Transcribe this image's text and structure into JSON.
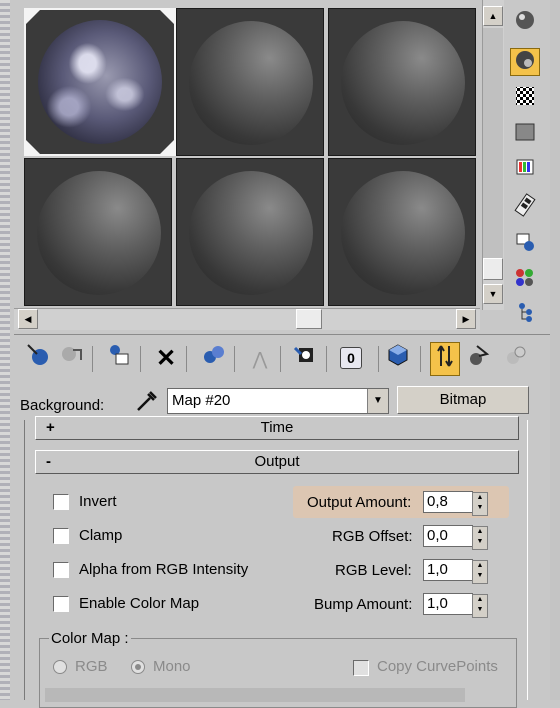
{
  "slots": {
    "icons": [
      "material-sphere-1",
      "blank-sphere-2",
      "blank-sphere-3",
      "blank-sphere-4",
      "blank-sphere-5",
      "blank-sphere-6"
    ]
  },
  "right_tools": [
    "sample-type-icon",
    "backlight-icon",
    "background-checker-icon",
    "sample-uv-tiling-icon",
    "video-color-check-icon",
    "make-preview-icon",
    "options-icon",
    "select-by-material-icon",
    "material-map-navigator-icon"
  ],
  "toolbar": {
    "buttons": [
      "get-material-icon",
      "put-to-scene-icon",
      "assign-to-selection-icon",
      "reset-map-icon",
      "make-unique-icon",
      "put-to-library-icon",
      "material-id-channel-icon",
      "show-map-in-viewport-icon",
      "show-end-result-icon",
      "go-to-parent-icon",
      "go-forward-to-sibling-icon"
    ],
    "material_id_value": "0"
  },
  "background_row": {
    "label": "Background:",
    "map_name": "Map #20",
    "type_button": "Bitmap"
  },
  "rollouts": {
    "time": {
      "sign": "+",
      "title": "Time"
    },
    "output": {
      "sign": "-",
      "title": "Output"
    }
  },
  "output": {
    "checkboxes": {
      "invert": "Invert",
      "clamp": "Clamp",
      "alpha_from_rgb": "Alpha from RGB Intensity",
      "enable_color_map": "Enable Color Map"
    },
    "params": {
      "output_amount": {
        "label": "Output Amount:",
        "value": "0,8"
      },
      "rgb_offset": {
        "label": "RGB Offset:",
        "value": "0,0"
      },
      "rgb_level": {
        "label": "RGB Level:",
        "value": "1,0"
      },
      "bump_amount": {
        "label": "Bump Amount:",
        "value": "1,0"
      }
    }
  },
  "color_map": {
    "group_label": "Color Map :",
    "rgb": "RGB",
    "mono": "Mono",
    "copy_curve_points": "Copy CurvePoints"
  },
  "colors": {
    "active_button": "#f4c24a",
    "panel_bg": "#c8c8c8",
    "slot_bg": "#3a3a3a",
    "output_amount_highlight": "#dcc6b2"
  }
}
